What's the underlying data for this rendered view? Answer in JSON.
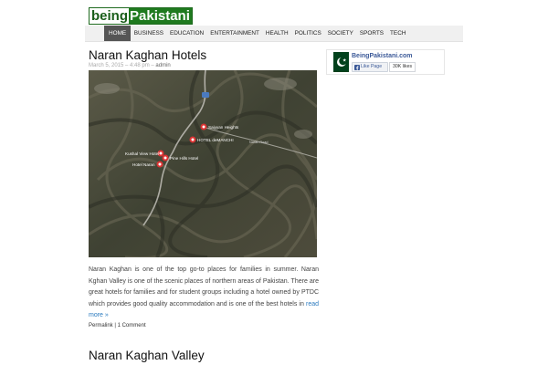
{
  "site": {
    "logo_part1": "being",
    "logo_part2": "Pakistani"
  },
  "nav": {
    "items": [
      {
        "label": "HOME"
      },
      {
        "label": "BUSINESS"
      },
      {
        "label": "EDUCATION"
      },
      {
        "label": "ENTERTAINMENT"
      },
      {
        "label": "HEALTH"
      },
      {
        "label": "POLITICS"
      },
      {
        "label": "SOCIETY"
      },
      {
        "label": "SPORTS"
      },
      {
        "label": "TECH"
      }
    ],
    "active_index": 0
  },
  "post": {
    "title": "Naran Kaghan Hotels",
    "date": "March 5, 2015 – 4:48 pm –",
    "author": "admin",
    "map_labels": {
      "l1": "Saiyyan Heights",
      "l2": "HOTEL deMANCHI",
      "l3": "Kushal View Hotel",
      "l4": "Pine Hills Hotel",
      "l5": "Hotel Naran",
      "road": "Naran Road"
    },
    "excerpt": "Naran Kaghan is one of the top go-to places for families in summer. Naran Kghan Valley is one of the scenic places of northern areas of Pakistan. There are great hotels for families and for student groups including a hotel owned by PTDC which provides good quality accommodation and is one of the best hotels in",
    "read_more": "read more »",
    "permalink": "Permalink",
    "separator": "|",
    "comments": "1 Comment"
  },
  "post2": {
    "title": "Naran Kaghan Valley"
  },
  "sidebar": {
    "fb": {
      "page_name": "BeingPakistani.com",
      "like_label": "Like Page",
      "likes": "30K likes"
    }
  },
  "colors": {
    "logo_green": "#1f7a1f",
    "link_blue": "#2a7abf",
    "nav_active": "#555555",
    "fb_blue": "#3b5998"
  }
}
